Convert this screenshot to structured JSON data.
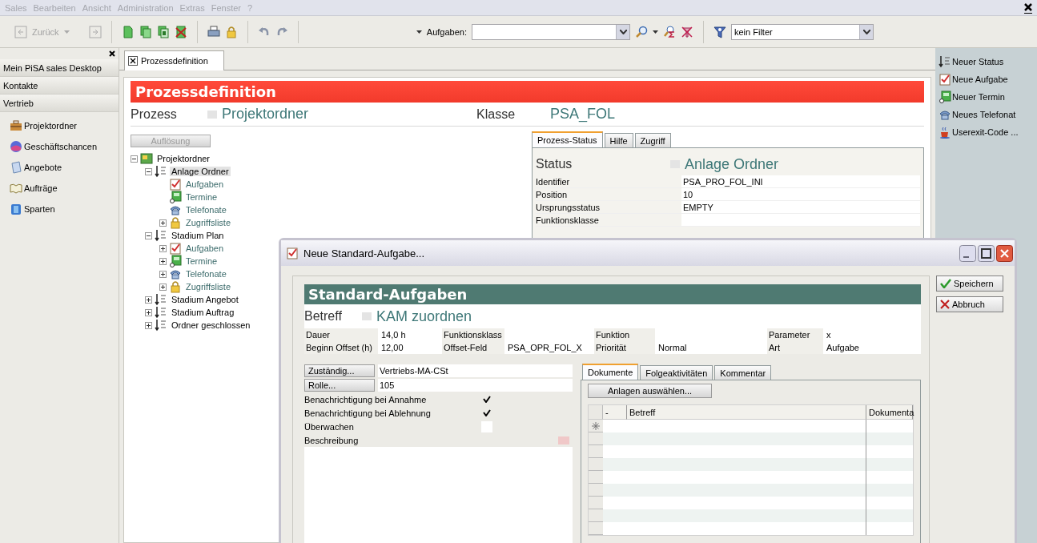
{
  "menu": [
    "Sales",
    "Bearbeiten",
    "Ansicht",
    "Administration",
    "Extras",
    "Fenster",
    "?"
  ],
  "toolbar": {
    "back_label": "Zurück",
    "back_disabled": true,
    "task_label": "Aufgaben:",
    "filter_value": "kein Filter"
  },
  "sidebar": {
    "sections": [
      "Mein PiSA sales Desktop",
      "Kontakte",
      "Vertrieb"
    ],
    "items": [
      {
        "label": "Projektordner",
        "kind": "folder"
      },
      {
        "label": "Geschäftschancen",
        "kind": "chances"
      },
      {
        "label": "Angebote",
        "kind": "offers"
      },
      {
        "label": "Aufträge",
        "kind": "orders"
      },
      {
        "label": "Sparten",
        "kind": "branches"
      }
    ]
  },
  "document_tab": {
    "label": "Prozessdefinition"
  },
  "header": {
    "title": "Prozessdefinition",
    "prozess_label": "Prozess",
    "prozess_value": "Projektordner",
    "klasse_label": "Klasse",
    "klasse_value": "PSA_FOL"
  },
  "resolve_button": {
    "label": "Auflösung",
    "disabled": true
  },
  "tree": [
    {
      "label": "Projektordner",
      "kind": "folder",
      "expanded": true,
      "selected": false,
      "children": [
        {
          "label": "Anlage Ordner",
          "kind": "status",
          "expanded": true,
          "selected": true,
          "children": [
            {
              "label": "Aufgaben",
              "kind": "task",
              "selected": false
            },
            {
              "label": "Termine",
              "kind": "appointment",
              "selected": false
            },
            {
              "label": "Telefonate",
              "kind": "phone",
              "selected": false
            },
            {
              "label": "Zugriffsliste",
              "kind": "lock",
              "expanded": false,
              "selected": false
            }
          ]
        },
        {
          "label": "Stadium Plan",
          "kind": "status",
          "expanded": true,
          "selected": false,
          "children": [
            {
              "label": "Aufgaben",
              "kind": "task",
              "expanded": false,
              "selected": false
            },
            {
              "label": "Termine",
              "kind": "appointment",
              "expanded": false,
              "selected": false
            },
            {
              "label": "Telefonate",
              "kind": "phone",
              "expanded": false,
              "selected": false
            },
            {
              "label": "Zugriffsliste",
              "kind": "lock",
              "expanded": false,
              "selected": false
            }
          ]
        },
        {
          "label": "Stadium Angebot",
          "kind": "status",
          "expanded": false,
          "selected": false
        },
        {
          "label": "Stadium Auftrag",
          "kind": "status",
          "expanded": false,
          "selected": false
        },
        {
          "label": "Ordner geschlossen",
          "kind": "status",
          "expanded": false,
          "selected": false
        }
      ]
    }
  ],
  "status_tabs": [
    {
      "label": "Prozess-Status",
      "selected": true
    },
    {
      "label": "Hilfe",
      "selected": false
    },
    {
      "label": "Zugriff",
      "selected": false
    }
  ],
  "status": {
    "label": "Status",
    "value": "Anlage Ordner",
    "rows": [
      {
        "label": "Identifier",
        "value": "PSA_PRO_FOL_INI"
      },
      {
        "label": "Position",
        "value": "10"
      },
      {
        "label": "Ursprungsstatus",
        "value": "EMPTY"
      },
      {
        "label": "Funktionsklasse"
      }
    ]
  },
  "actions": [
    {
      "label": "Neuer Status",
      "kind": "status"
    },
    {
      "label": "Neue Aufgabe",
      "kind": "task"
    },
    {
      "label": "Neuer Termin",
      "kind": "appointment"
    },
    {
      "label": "Neues Telefonat",
      "kind": "phone"
    },
    {
      "label": "Userexit-Code ...",
      "kind": "code"
    }
  ],
  "dialog": {
    "title": "Neue Standard-Aufgabe...",
    "heading": "Standard-Aufgaben",
    "subject_label": "Betreff",
    "subject_value": "KAM zuordnen",
    "fields": [
      {
        "label": "Dauer",
        "value": "14,0 h"
      },
      {
        "label": "Funktionsklass"
      },
      {
        "label": "Funktion"
      },
      {
        "label": "Parameter",
        "value": "x"
      },
      {
        "label": "Beginn Offset (h)",
        "value": "12,00"
      },
      {
        "label": "Offset-Feld",
        "value": "PSA_OPR_FOL_X"
      },
      {
        "label": "Priorität",
        "value": "Normal"
      },
      {
        "label": "Art",
        "value": "Aufgabe"
      }
    ],
    "assign": [
      {
        "button": "Zuständig...",
        "value": "Vertriebs-MA-CSt"
      },
      {
        "button": "Rolle...",
        "value": "105"
      }
    ],
    "checks": [
      {
        "label": "Benachrichtigung bei Annahme",
        "checked": true
      },
      {
        "label": "Benachrichtigung bei Ablehnung",
        "checked": true
      },
      {
        "label": "Überwachen",
        "checked": false
      }
    ],
    "description_label": "Beschreibung",
    "tabs": [
      {
        "label": "Dokumente",
        "selected": true
      },
      {
        "label": "Folgeaktivitäten",
        "selected": false
      },
      {
        "label": "Kommentar",
        "selected": false
      }
    ],
    "attach_button": "Anlagen auswählen...",
    "grid_columns": [
      "-",
      "Betreff",
      "Dokumenta"
    ],
    "buttons": [
      {
        "label": "Speichern",
        "kind": "save"
      },
      {
        "label": "Abbruch",
        "kind": "cancel"
      }
    ]
  }
}
